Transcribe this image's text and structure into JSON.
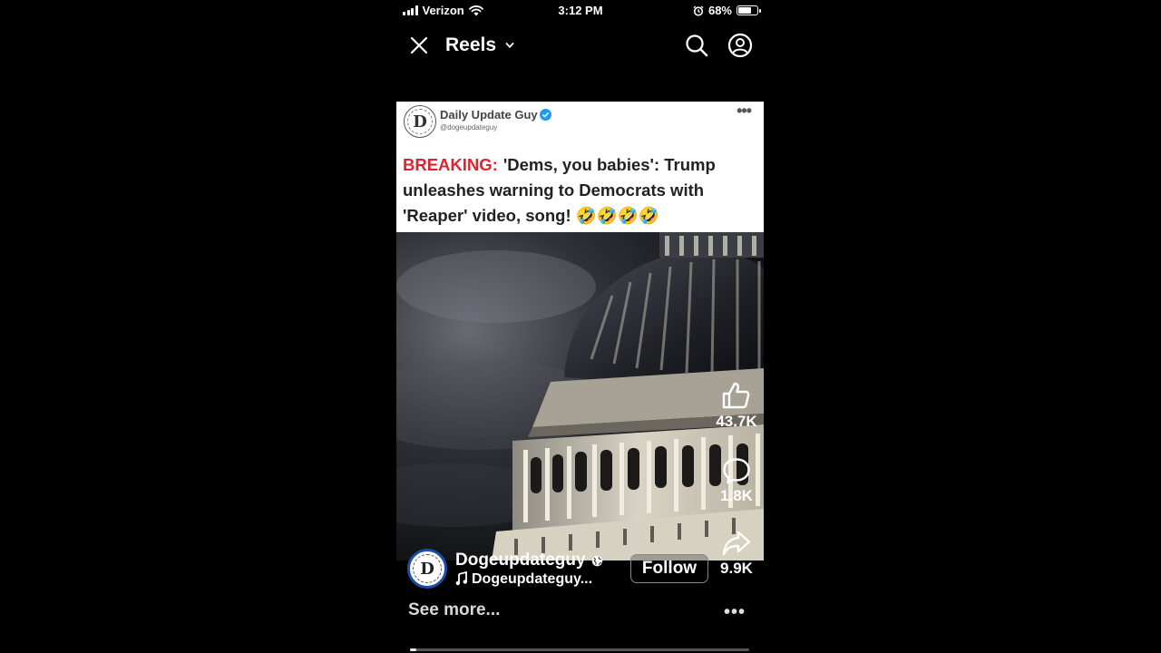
{
  "status_bar": {
    "carrier": "Verizon",
    "time": "3:12 PM",
    "battery": "68%",
    "battery_level": 0.68,
    "icons": [
      "signal-icon",
      "wifi-icon",
      "alarm-icon",
      "battery-icon"
    ]
  },
  "nav": {
    "title": "Reels",
    "icons": [
      "close-icon",
      "chevron-down-icon",
      "search-icon",
      "profile-icon"
    ]
  },
  "post": {
    "account_name": "Daily Update Guy",
    "account_handle": "@dogeupdateguy",
    "avatar_letter": "D",
    "avatar_ring_text": "DAILY UPDATE GUY",
    "more": "•••",
    "breaking_tag": "BREAKING:",
    "headline": "'Dems, you babies': Trump unleashes warning to Democrats with 'Reaper' video, song! 🤣🤣🤣🤣"
  },
  "actions": {
    "likes": "43.7K",
    "comments": "1.8K",
    "shares": "9.9K",
    "icons": [
      "like-icon",
      "comment-icon",
      "share-icon"
    ]
  },
  "author": {
    "name": "Dogeupdateguy",
    "audio": "Dogeupdateguy...",
    "avatar_letter": "D",
    "follow_label": "Follow"
  },
  "footer": {
    "see_more": "See more...",
    "more": "•••",
    "progress": 0.02
  },
  "colors": {
    "background": "#000000",
    "breaking_red": "#e0242f",
    "verified_blue": "#1d9bf0"
  }
}
